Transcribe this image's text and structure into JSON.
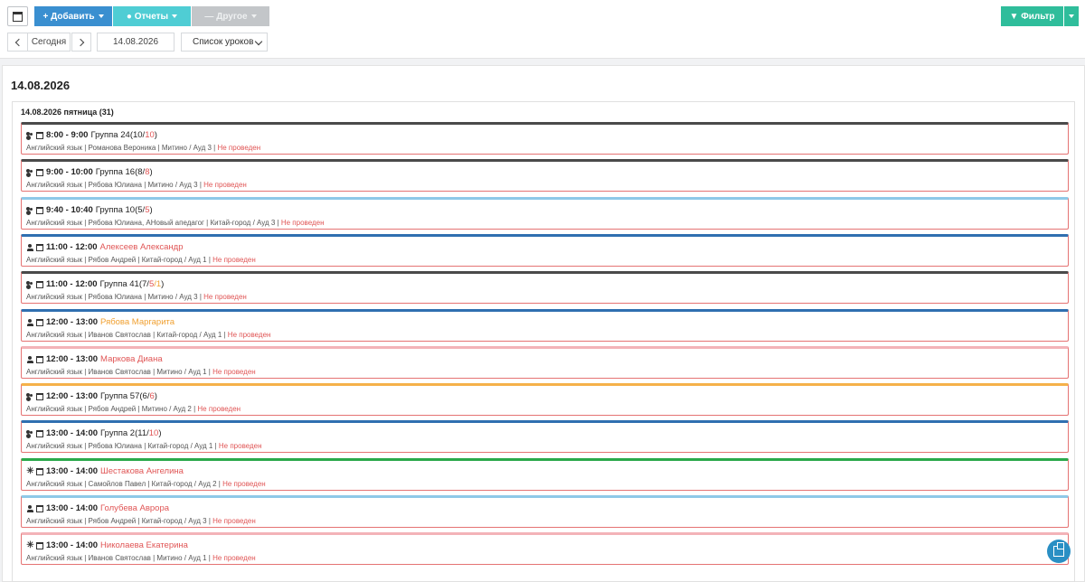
{
  "toolbar": {
    "add_label": "Добавить",
    "reports_label": "Отчеты",
    "other_label": "Другое",
    "filter_label": "Фильтр",
    "today_label": "Сегодня",
    "date_value": "14.08.2026",
    "view_select": "Список уроков"
  },
  "page": {
    "title": "14.08.2026",
    "day_header": "14.08.2026 пятница (31)"
  },
  "colors": {
    "lesson_border": "#e57373",
    "dark": "#4a4a4a",
    "light_blue": "#8fc9e8",
    "blue": "#2f6fb0",
    "pink": "#f3b3b8",
    "orange": "#f5b14a",
    "green": "#2aa84a"
  },
  "lessons": [
    {
      "icon": "group-icon",
      "accent": "dark",
      "time": "8:00 - 9:00",
      "name": "Группа 24",
      "name_color": "",
      "count_open": "(10/",
      "count_red": "10",
      "count_mid": "",
      "count_close": ")",
      "details": "Английский язык | Романова Вероника | Митино / Ауд 3 | ",
      "status": "Не проведен"
    },
    {
      "icon": "group-icon",
      "accent": "dark",
      "time": "9:00 - 10:00",
      "name": "Группа 16",
      "name_color": "",
      "count_open": "(8/",
      "count_red": "8",
      "count_mid": "",
      "count_close": ")",
      "details": "Английский язык | Рябова Юлиана | Митино / Ауд 3 | ",
      "status": "Не проведен"
    },
    {
      "icon": "group-icon",
      "accent": "light_blue",
      "time": "9:40 - 10:40",
      "name": "Группа 10",
      "name_color": "",
      "count_open": "(5/",
      "count_red": "5",
      "count_mid": "",
      "count_close": ")",
      "details": "Английский язык | Рябова Юлиана, АНовый апедагог | Китай-город / Ауд 3 | ",
      "status": "Не проведен"
    },
    {
      "icon": "person-icon",
      "accent": "blue",
      "time": "11:00 - 12:00",
      "name": "Алексеев Александр",
      "name_color": "red",
      "count_open": "",
      "count_red": "",
      "count_mid": "",
      "count_close": "",
      "details": "Английский язык | Рябов Андрей | Китай-город / Ауд 1 | ",
      "status": "Не проведен"
    },
    {
      "icon": "group-icon",
      "accent": "dark",
      "time": "11:00 - 12:00",
      "name": "Группа 41",
      "name_color": "",
      "count_open": "(7/",
      "count_red": "5",
      "count_mid": "/1",
      "count_close": ")",
      "details": "Английский язык | Рябова Юлиана | Митино / Ауд 3 | ",
      "status": "Не проведен"
    },
    {
      "icon": "person-icon",
      "accent": "blue",
      "time": "12:00 - 13:00",
      "name": "Рябова Маргарита",
      "name_color": "orange",
      "count_open": "",
      "count_red": "",
      "count_mid": "",
      "count_close": "",
      "details": "Английский язык | Иванов Святослав | Китай-город / Ауд 1 | ",
      "status": "Не проведен"
    },
    {
      "icon": "person-icon",
      "accent": "pink",
      "time": "12:00 - 13:00",
      "name": "Маркова Диана",
      "name_color": "red",
      "count_open": "",
      "count_red": "",
      "count_mid": "",
      "count_close": "",
      "details": "Английский язык | Иванов Святослав | Митино / Ауд 1 | ",
      "status": "Не проведен"
    },
    {
      "icon": "group-icon",
      "accent": "orange",
      "time": "12:00 - 13:00",
      "name": "Группа 57",
      "name_color": "",
      "count_open": "(6/",
      "count_red": "6",
      "count_mid": "",
      "count_close": ")",
      "details": "Английский язык | Рябов Андрей | Митино / Ауд 2 | ",
      "status": "Не проведен"
    },
    {
      "icon": "group-icon",
      "accent": "blue",
      "time": "13:00 - 14:00",
      "name": "Группа 2",
      "name_color": "",
      "count_open": "(11/",
      "count_red": "10",
      "count_mid": "",
      "count_close": ")",
      "details": "Английский язык | Рябова Юлиана | Китай-город / Ауд 1 | ",
      "status": "Не проведен"
    },
    {
      "icon": "snowflake-icon",
      "accent": "green",
      "time": "13:00 - 14:00",
      "name": "Шестакова Ангелина",
      "name_color": "red",
      "count_open": "",
      "count_red": "",
      "count_mid": "",
      "count_close": "",
      "details": "Английский язык | Самойлов Павел | Китай-город / Ауд 2 | ",
      "status": "Не проведен"
    },
    {
      "icon": "person-icon",
      "accent": "light_blue",
      "time": "13:00 - 14:00",
      "name": "Голубева Аврора",
      "name_color": "red",
      "count_open": "",
      "count_red": "",
      "count_mid": "",
      "count_close": "",
      "details": "Английский язык | Рябов Андрей | Китай-город / Ауд 3 | ",
      "status": "Не проведен"
    },
    {
      "icon": "snowflake-icon",
      "accent": "pink",
      "time": "13:00 - 14:00",
      "name": "Николаева Екатерина",
      "name_color": "red",
      "count_open": "",
      "count_red": "",
      "count_mid": "",
      "count_close": "",
      "details": "Английский язык | Иванов Святослав | Митино / Ауд 1 | ",
      "status": "Не проведен"
    }
  ]
}
